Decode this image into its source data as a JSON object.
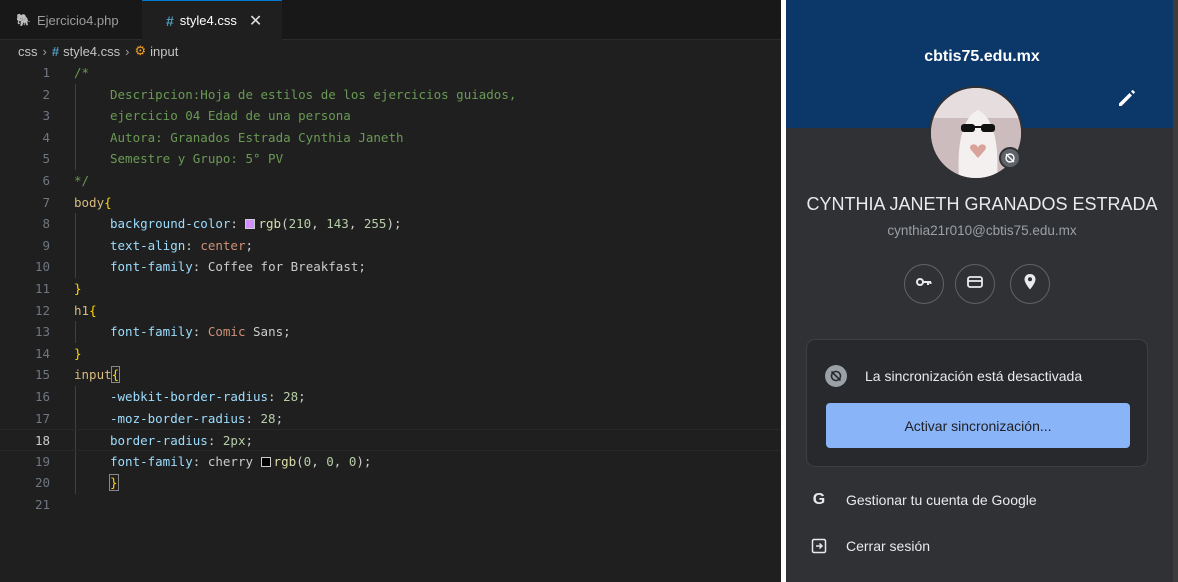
{
  "editor": {
    "tabs": [
      {
        "label": "Ejercicio4.php",
        "icon": "php-elephant-icon"
      },
      {
        "label": "style4.css",
        "icon": "css-hash-icon",
        "close": "✕"
      }
    ],
    "breadcrumb": {
      "folder": "css",
      "file": "style4.css",
      "symbol": "input"
    },
    "current_line": 18,
    "line_numbers": [
      "1",
      "2",
      "3",
      "4",
      "5",
      "6",
      "7",
      "8",
      "9",
      "10",
      "11",
      "12",
      "13",
      "14",
      "15",
      "16",
      "17",
      "18",
      "19",
      "20",
      "21"
    ],
    "lines": {
      "l1": "/*",
      "l2": "Descripcion:Hoja de estilos de los ejercicios guiados,",
      "l3": "ejercicio 04 Edad de una persona",
      "l4": "Autora: Granados Estrada Cynthia Janeth",
      "l5": "Semestre y Grupo: 5° PV",
      "l6": "*/",
      "l7_sel": "body",
      "l7_brace": "{",
      "l8_prop": "background-color",
      "l8_colon": ": ",
      "l8_fn": "rgb",
      "l8_args_open": "(",
      "l8_n1": "210",
      "l8_c1": ", ",
      "l8_n2": "143",
      "l8_c2": ", ",
      "l8_n3": "255",
      "l8_end": ");",
      "l9_prop": "text-align",
      "l9_colon": ": ",
      "l9_val": "center",
      "l9_end": ";",
      "l10_prop": "font-family",
      "l10_colon": ": ",
      "l10_val": "Coffee for Breakfast",
      "l10_end": ";",
      "l11": "}",
      "l12_sel": "h1",
      "l12_brace": "{",
      "l13_prop": "font-family",
      "l13_colon": ": ",
      "l13_val": "Comic",
      "l13_rest": " Sans;",
      "l14": "}",
      "l15_sel": "input",
      "l15_brace": "{",
      "l16_prop": "-webkit-border-radius",
      "l16_colon": ": ",
      "l16_num": "28",
      "l16_end": ";",
      "l17_prop": "-moz-border-radius",
      "l17_colon": ": ",
      "l17_num": "28",
      "l17_end": ";",
      "l18_prop": "border-radius",
      "l18_colon": ": ",
      "l18_num": "2px",
      "l18_end": ";",
      "l19_prop": "font-family",
      "l19_colon": ": ",
      "l19_val": "cherry ",
      "l19_fn": "rgb",
      "l19_args_open": "(",
      "l19_n1": "0",
      "l19_c1": ", ",
      "l19_n2": "0",
      "l19_c2": ", ",
      "l19_n3": "0",
      "l19_end": ");",
      "l20": "}"
    },
    "swatch_colors": {
      "l8": "#d28fff",
      "l19": "#000000"
    }
  },
  "profile": {
    "domain": "cbtis75.edu.mx",
    "name": "CYNTHIA JANETH GRANADOS ESTRADA",
    "email": "cynthia21r010@cbtis75.edu.mx",
    "shortcut_icons": [
      "key-icon",
      "card-icon",
      "location-pin-icon"
    ],
    "sync_status": "La sincronización está desactivada",
    "sync_button": "Activar sincronización...",
    "menu": [
      {
        "label": "Gestionar tu cuenta de Google",
        "icon": "google-g-icon",
        "icon_text": "G"
      },
      {
        "label": "Cerrar sesión",
        "icon": "sign-out-icon"
      }
    ],
    "colors": {
      "banner": "#0b3868",
      "panel": "#303134",
      "accent": "#8ab4f8"
    }
  }
}
